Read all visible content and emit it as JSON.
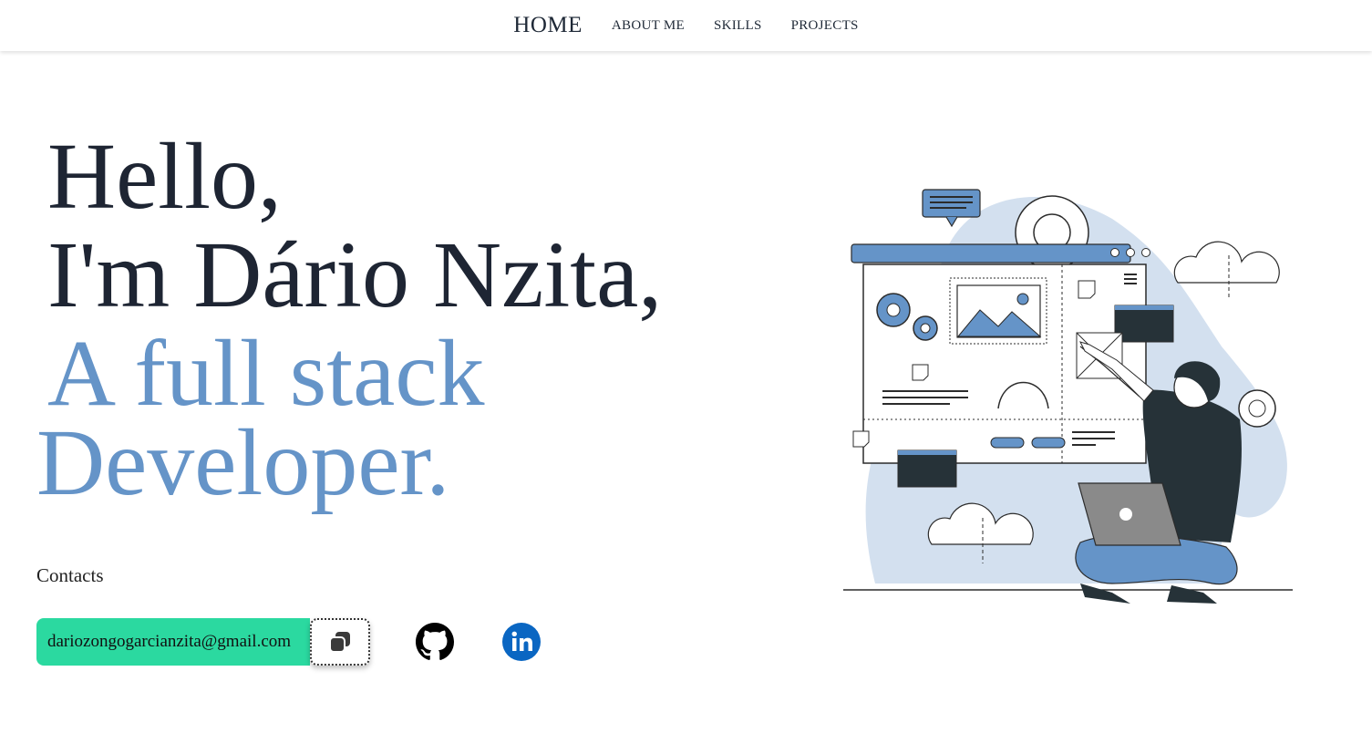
{
  "nav": {
    "home": "HOME",
    "about": "ABOUT ME",
    "skills": "SKILLS",
    "projects": "PROJECTS"
  },
  "hero": {
    "line1": "Hello,",
    "line2": "I'm Dário Nzita,",
    "line3": "A full stack",
    "line4": "Developer."
  },
  "contacts": {
    "label": "Contacts",
    "email": "dariozongogarcianzita@gmail.com"
  },
  "icons": {
    "copy": "copy-icon",
    "github": "github-icon",
    "linkedin": "linkedin-icon"
  },
  "colors": {
    "accent_blue": "#6594c8",
    "email_bg": "#2bd9a0",
    "text_dark": "#1e2533",
    "linkedin": "#0a66c2"
  }
}
